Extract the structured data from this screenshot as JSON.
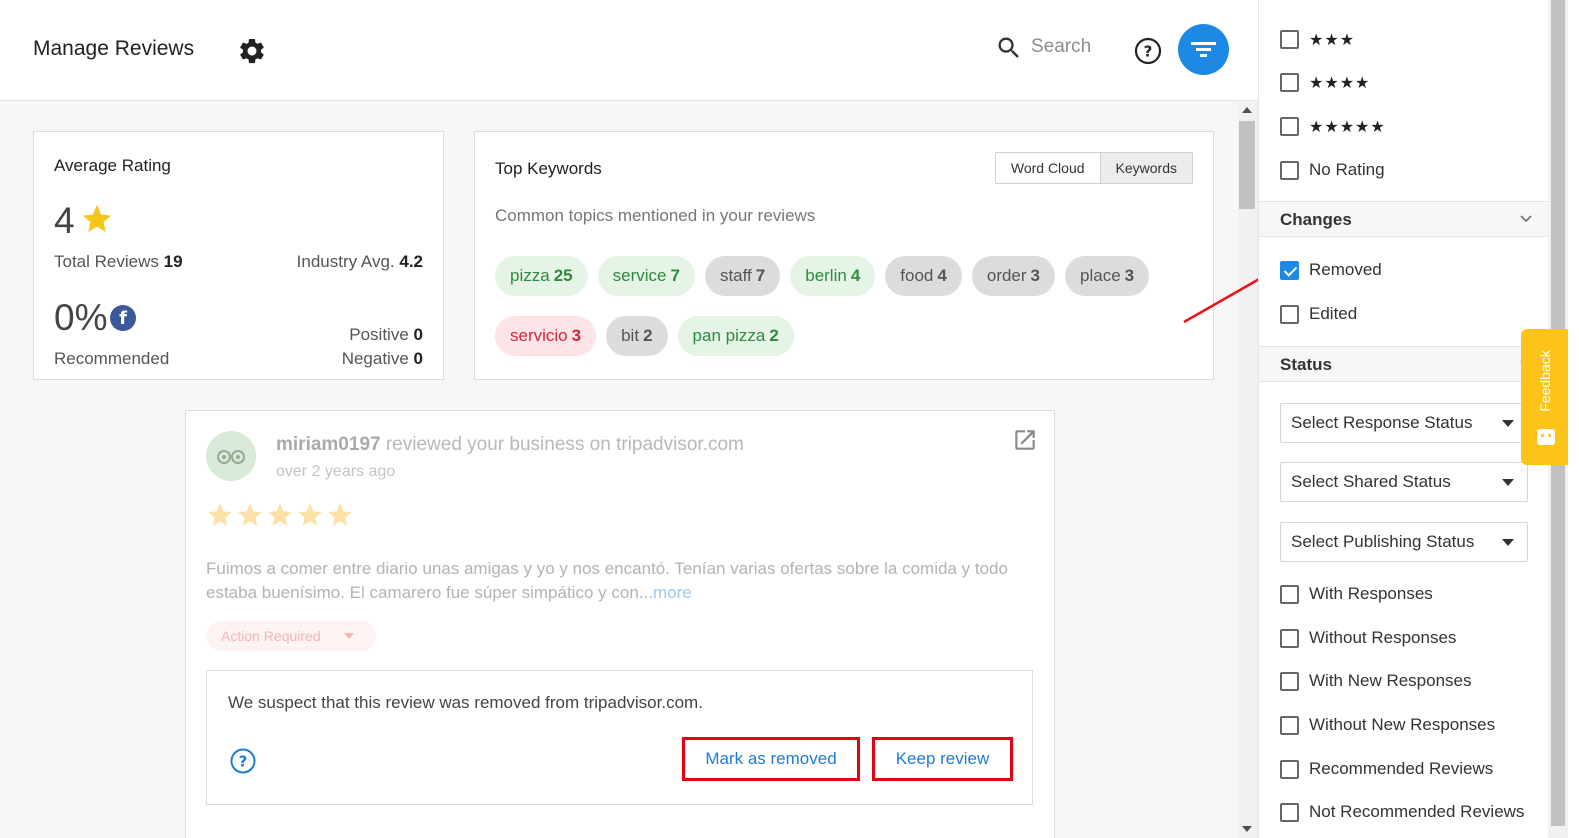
{
  "header": {
    "title": "Manage Reviews",
    "search_placeholder": "Search"
  },
  "average_rating": {
    "title": "Average Rating",
    "value": "4",
    "total_label": "Total Reviews",
    "total_value": "19",
    "industry_label": "Industry Avg.",
    "industry_value": "4.2",
    "recommend_pct": "0%",
    "recommended_label": "Recommended",
    "positive_label": "Positive",
    "positive_value": "0",
    "negative_label": "Negative",
    "negative_value": "0",
    "star_color": "#f5c518"
  },
  "keywords": {
    "title": "Top Keywords",
    "subtitle": "Common topics mentioned in your reviews",
    "toggle": [
      "Word Cloud",
      "Keywords"
    ],
    "active_toggle": "Keywords",
    "chips": [
      {
        "word": "pizza",
        "count": "25",
        "sentiment": "pos"
      },
      {
        "word": "service",
        "count": "7",
        "sentiment": "pos"
      },
      {
        "word": "staff",
        "count": "7",
        "sentiment": "neu"
      },
      {
        "word": "berlin",
        "count": "4",
        "sentiment": "pos"
      },
      {
        "word": "food",
        "count": "4",
        "sentiment": "neu"
      },
      {
        "word": "order",
        "count": "3",
        "sentiment": "neu"
      },
      {
        "word": "place",
        "count": "3",
        "sentiment": "neu"
      },
      {
        "word": "servicio",
        "count": "3",
        "sentiment": "neg"
      },
      {
        "word": "bit",
        "count": "2",
        "sentiment": "neu"
      },
      {
        "word": "pan pizza",
        "count": "2",
        "sentiment": "pos"
      }
    ]
  },
  "review": {
    "author": "miriam0197",
    "header_suffix": "reviewed your business on tripadvisor.com",
    "time": "over 2 years ago",
    "stars": 5,
    "text": "Fuimos a comer entre diario unas amigas y yo y nos encantó. Tenían varias ofertas sobre la comida y todo estaba buenísimo. El camarero fue súper simpático y con...",
    "more_label": "more",
    "status_label": "Action Required",
    "removed_message": "We suspect that this review was removed from tripadvisor.com.",
    "mark_removed_label": "Mark as removed",
    "keep_review_label": "Keep review"
  },
  "filter_panel": {
    "rating_items": [
      {
        "label": "★★★",
        "checked": false
      },
      {
        "label": "★★★★",
        "checked": false
      },
      {
        "label": "★★★★★",
        "checked": false
      },
      {
        "label": "No Rating",
        "checked": false
      }
    ],
    "changes_title": "Changes",
    "changes_items": [
      {
        "label": "Removed",
        "checked": true
      },
      {
        "label": "Edited",
        "checked": false
      }
    ],
    "status_title": "Status",
    "selects": [
      "Select Response Status",
      "Select Shared Status",
      "Select Publishing Status"
    ],
    "status_items": [
      {
        "label": "With Responses",
        "checked": false
      },
      {
        "label": "Without Responses",
        "checked": false
      },
      {
        "label": "With New Responses",
        "checked": false
      },
      {
        "label": "Without New Responses",
        "checked": false
      },
      {
        "label": "Recommended Reviews",
        "checked": false
      },
      {
        "label": "Not Recommended Reviews",
        "checked": false
      }
    ]
  },
  "feedback_label": "Feedback",
  "colors": {
    "accent": "#1e88e5",
    "highlight_border": "#e3000f",
    "feedback": "#fcc419"
  }
}
